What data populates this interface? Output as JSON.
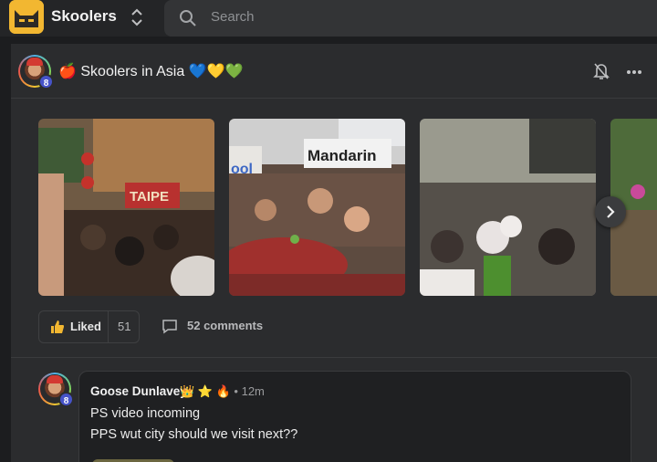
{
  "app": {
    "brand": "Skoolers",
    "search_placeholder": "Search"
  },
  "post": {
    "group_title": "Skoolers in Asia",
    "group_emoji_prefix": "🍎",
    "group_emoji_suffix": "💙💛💚",
    "author_level": "8",
    "photos": [
      {
        "name": "taipei-parade",
        "sign_text": "TAIPE"
      },
      {
        "name": "mandarin-crowd",
        "sign_text": "Mandarin",
        "side_text": "ool"
      },
      {
        "name": "street-crowd"
      },
      {
        "name": "partial-photo"
      }
    ],
    "like_label": "Liked",
    "like_count": "51",
    "comments_label": "52 comments"
  },
  "comment": {
    "author": "Goose Dunlavey",
    "badges": "👑 ⭐ 🔥",
    "time": "12m",
    "level": "8",
    "lines": [
      "PS video incoming",
      "PPS wut city should we visit next??"
    ]
  },
  "colors": {
    "background": "#1c1d1f",
    "card": "#2b2c2e",
    "logo": "#f2b731",
    "level_badge": "#4653c9"
  }
}
